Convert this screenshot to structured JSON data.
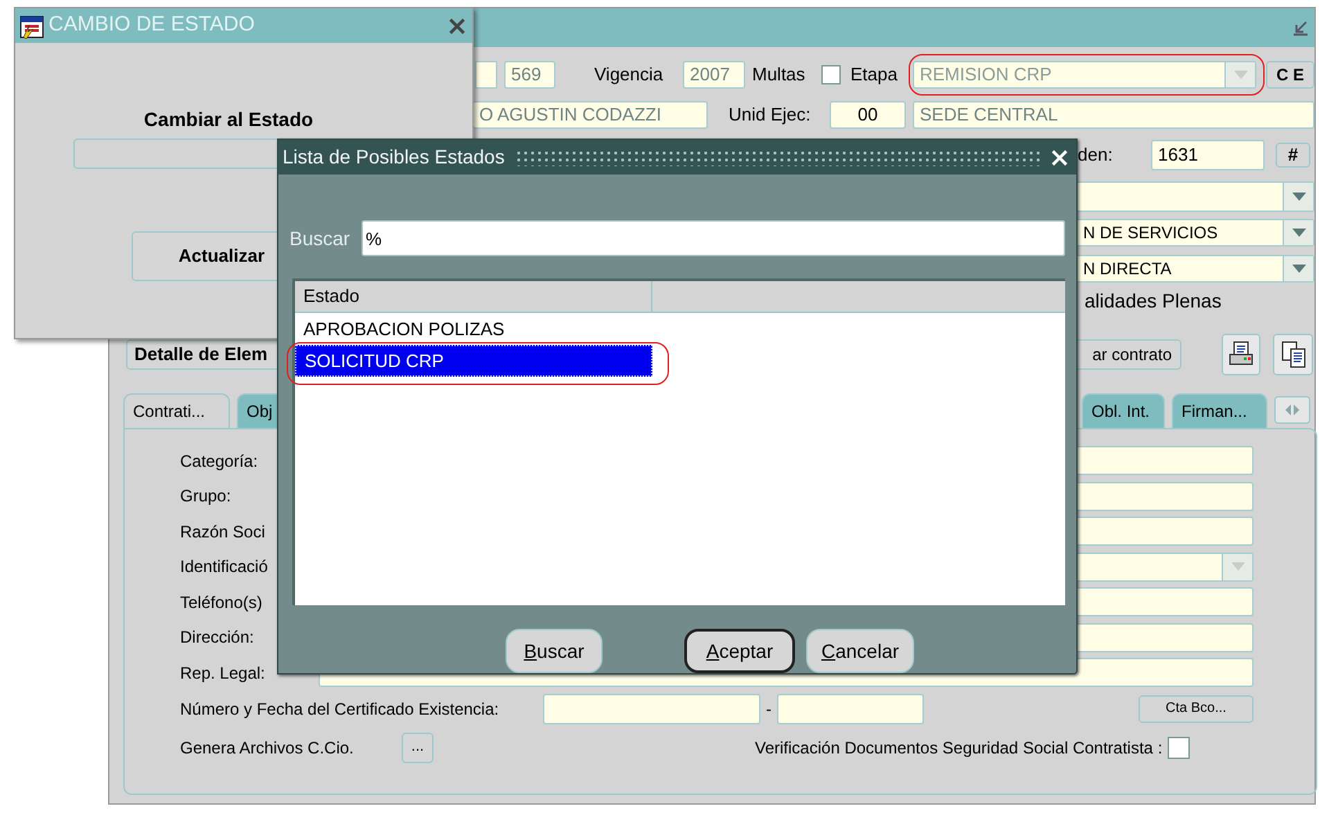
{
  "main_window": {
    "header": {
      "number": {
        "value": "569",
        "disabled": true
      },
      "vigencia_label": "Vigencia",
      "vigencia": {
        "value": "2007",
        "disabled": true
      },
      "multas_label": "Multas",
      "multas_checked": false,
      "etapa_label": "Etapa",
      "etapa": {
        "value": "REMISION CRP",
        "disabled": true,
        "highlighted": true
      },
      "ce_button": "C E",
      "entity": {
        "value": "O AGUSTIN CODAZZI",
        "disabled": true
      },
      "unid_label": "Unid Ejec:",
      "unid": {
        "value": "00",
        "disabled": false
      },
      "sede": {
        "value": "SEDE CENTRAL",
        "disabled": true
      },
      "orden_label": "den:",
      "orden": {
        "value": "1631",
        "disabled": false
      },
      "hash_button": "#"
    },
    "dropdowns": [
      {
        "value": "N DE SERVICIOS"
      },
      {
        "value": "N DIRECTA"
      }
    ],
    "facultades_text": "alidades Plenas",
    "detalle_button": "Detalle de Elem",
    "contrato_button": "ar contrato",
    "tabs": [
      {
        "label": "Contrati...",
        "selected": true
      },
      {
        "label": "Obj",
        "selected": false
      },
      {
        "label": "Obl. Int.",
        "selected": false
      },
      {
        "label": "Firman...",
        "selected": false
      }
    ],
    "form_rows": [
      {
        "label": "Categoría:",
        "kind": "text"
      },
      {
        "label": "Grupo:",
        "kind": "text"
      },
      {
        "label": "Razón Soci",
        "kind": "text"
      },
      {
        "label": "Identificació",
        "kind": "dropdown"
      },
      {
        "label": "Teléfono(s)",
        "kind": "text"
      },
      {
        "label": "Dirección:",
        "kind": "text"
      },
      {
        "label": "Rep. Legal:",
        "kind": "wide"
      }
    ],
    "certificado_label": "Número y Fecha del Certificado Existencia:",
    "separator": "-",
    "cta_button": "Cta Bco...",
    "genera_label": "Genera Archivos C.Cio.",
    "dots_button": "...",
    "verificacion_label": "Verificación Documentos Seguridad Social Contratista :",
    "verificacion_checked": false
  },
  "cambio_window": {
    "title": "CAMBIO DE ESTADO",
    "heading": "Cambiar al Estado",
    "button": "Actualizar"
  },
  "lista_dialog": {
    "title": "Lista de Posibles Estados",
    "search_label": "Buscar",
    "search_value": "%",
    "columns": [
      "Estado"
    ],
    "rows": [
      {
        "estado": "APROBACION POLIZAS",
        "selected": false,
        "highlighted": false
      },
      {
        "estado": "SOLICITUD CRP",
        "selected": true,
        "highlighted": true
      }
    ],
    "buttons": [
      {
        "label": "Buscar",
        "default": false
      },
      {
        "label": "Aceptar",
        "default": true
      },
      {
        "label": "Cancelar",
        "default": false
      }
    ]
  }
}
